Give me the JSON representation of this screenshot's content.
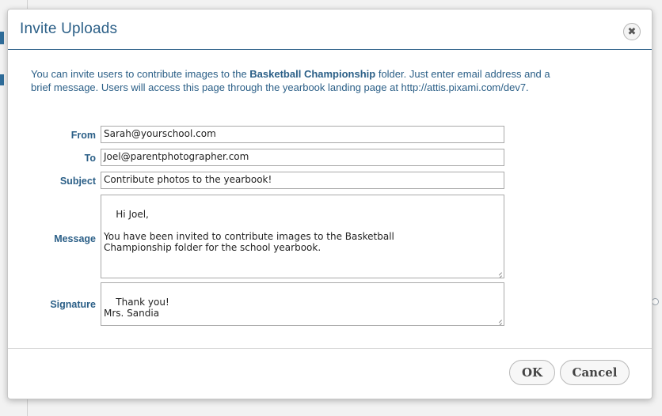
{
  "dialog": {
    "title": "Invite Uploads",
    "close_icon": "close-icon",
    "intro_part1": "You can invite users to contribute images to the ",
    "intro_folder": "Basketball Championship",
    "intro_part2": " folder. Just enter email address and a brief message. Users will access this page through the yearbook landing page at http://attis.pixami.com/dev7."
  },
  "form": {
    "from_label": "From",
    "from_value": "Sarah@yourschool.com",
    "to_label": "To",
    "to_value": "Joel@parentphotographer.com",
    "subject_label": "Subject",
    "subject_value": "Contribute photos to the yearbook!",
    "message_label": "Message",
    "message_value": "Hi Joel,\n\nYou have been invited to contribute images to the Basketball\nChampionship folder for the school yearbook.",
    "signature_label": "Signature",
    "signature_value": "Thank you!\nMrs. Sandia"
  },
  "buttons": {
    "ok_label": "OK",
    "cancel_label": "Cancel"
  },
  "colors": {
    "accent": "#2b5f87",
    "border": "#a9a9a9"
  }
}
